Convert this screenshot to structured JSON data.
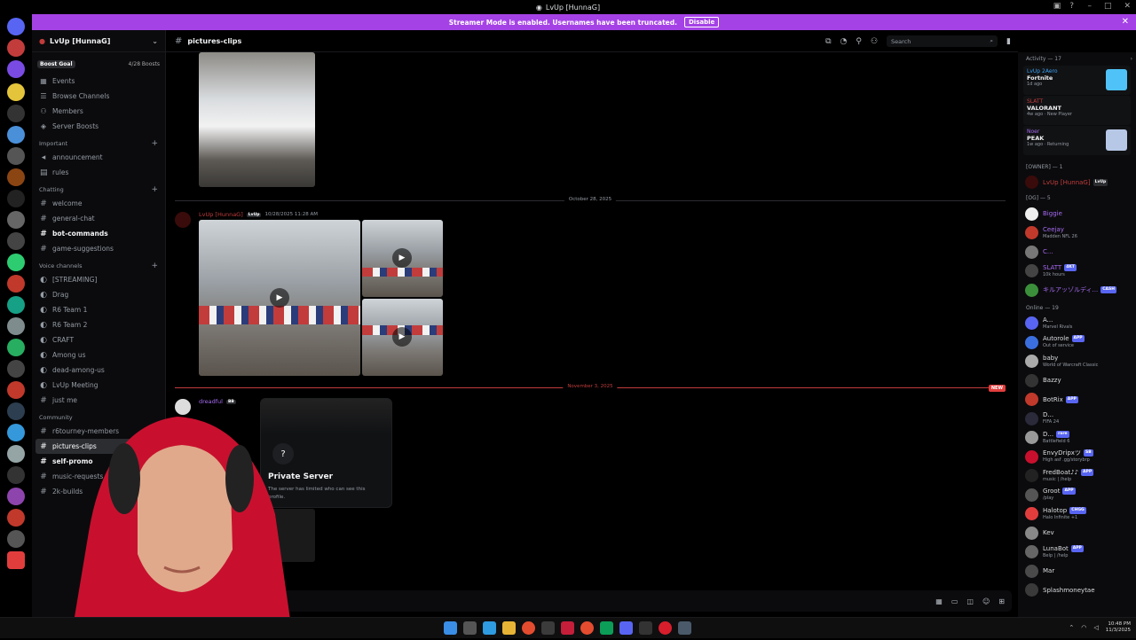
{
  "window": {
    "title": "LvUp [HunnaG]"
  },
  "banner": {
    "text": "Streamer Mode is enabled. Usernames have been truncated.",
    "button": "Disable"
  },
  "server": {
    "name": "LvUp [HunnaG]",
    "boost_goal": "Boost Goal",
    "boost_count": "4/28 Boosts",
    "nav": [
      {
        "label": "Events",
        "icon": "calendar-icon"
      },
      {
        "label": "Browse Channels",
        "icon": "list-icon"
      },
      {
        "label": "Members",
        "icon": "members-icon"
      },
      {
        "label": "Server Boosts",
        "icon": "boost-icon"
      }
    ],
    "categories": {
      "important": "Important",
      "chatting": "Chatting",
      "voice": "Voice channels",
      "community": "Community"
    },
    "important_channels": [
      "announcement",
      "rules"
    ],
    "chatting_channels": [
      "welcome",
      "general-chat",
      "bot-commands",
      "game-suggestions"
    ],
    "voice_channels": [
      "[STREAMING]",
      "Drag",
      "R6 Team 1",
      "R6 Team 2",
      "CRAFT",
      "Among us",
      "dead-among-us",
      "LvUp Meeting",
      "just me"
    ],
    "community_channels": [
      "r6tourney-members",
      "pictures-clips",
      "self-promo",
      "music-requests",
      "2k-builds"
    ]
  },
  "channel": {
    "name": "pictures-clips",
    "search_placeholder": "Search",
    "date1": "October 28, 2025",
    "date2": "November 3, 2025",
    "new_pill": "NEW",
    "author1": "LvUp [HunnaG]",
    "author1_tag": "LvUp",
    "author1_time": "10/28/2025 11:28 AM",
    "author2": "dreadful",
    "author2_tag": "BB"
  },
  "popup": {
    "title": "Private Server",
    "desc": "The server has limited who can see this profile."
  },
  "members": {
    "activity_header": "Activity — 17",
    "activities": [
      {
        "user": "LvUp 2Aero",
        "game": "Fortnite",
        "meta": "1d ago",
        "color": "#3ba2f5",
        "thumb": "#4fc3f7"
      },
      {
        "user": "SLATT",
        "game": "VALORANT",
        "meta": "4w ago · New Player",
        "color": "#c23c3c",
        "thumb": "#111214"
      },
      {
        "user": "Noer",
        "game": "PEAK",
        "meta": "1w ago · Returning",
        "color": "#a66bf2",
        "thumb": "#b7c8e6"
      }
    ],
    "owner_header": "[OWNER] — 1",
    "owner": {
      "name": "LvUp [HunnaG]",
      "tag": "LvUp"
    },
    "og_header": "[OG] — 5",
    "og": [
      {
        "name": "Biggie",
        "sub": "",
        "tag": ""
      },
      {
        "name": "Ceejay",
        "sub": "Madden NFL 26",
        "tag": ""
      },
      {
        "name": "C...",
        "sub": "",
        "tag": ""
      },
      {
        "name": "SLATT",
        "sub": "10k hours",
        "tag": "4KT"
      },
      {
        "name": "キルアッゾルディ...",
        "sub": "",
        "tag": "CASH"
      }
    ],
    "online_header": "Online — 19",
    "online": [
      {
        "name": "A...",
        "sub": "Marvel Rivals",
        "tag": ""
      },
      {
        "name": "Autorole",
        "sub": "Out of service",
        "tag": "APP"
      },
      {
        "name": "baby",
        "sub": "World of Warcraft Classic",
        "tag": ""
      },
      {
        "name": "Bazzy",
        "sub": "",
        "tag": ""
      },
      {
        "name": "BotRix",
        "sub": "",
        "tag": "APP"
      },
      {
        "name": "D...",
        "sub": "FIFA 24",
        "tag": ""
      },
      {
        "name": "D...",
        "sub": "Battlefield 6",
        "tag": "rare"
      },
      {
        "name": "EnvyDripxツ",
        "sub": "High asf .gg/storybrp",
        "tag": "SB"
      },
      {
        "name": "FredBoat♪♪",
        "sub": "music | /help",
        "tag": "APP"
      },
      {
        "name": "Groot",
        "sub": "/play",
        "tag": "APP"
      },
      {
        "name": "Halotop",
        "sub": "Halo Infinite +1",
        "tag": "CHGG"
      },
      {
        "name": "Kev",
        "sub": "",
        "tag": ""
      },
      {
        "name": "LunaBot",
        "sub": "Belp | /help",
        "tag": "APP"
      },
      {
        "name": "Mar",
        "sub": "",
        "tag": ""
      },
      {
        "name": "Splashmoneytae",
        "sub": "",
        "tag": ""
      }
    ]
  },
  "taskbar": {
    "time": "10:48 PM",
    "date": "11/3/2025"
  }
}
